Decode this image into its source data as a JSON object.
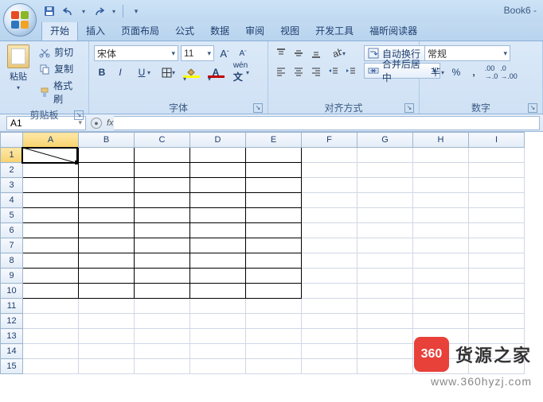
{
  "title": "Book6 -",
  "tabs": [
    "开始",
    "插入",
    "页面布局",
    "公式",
    "数据",
    "审阅",
    "视图",
    "开发工具",
    "福昕阅读器"
  ],
  "active_tab": 0,
  "clipboard": {
    "paste": "粘贴",
    "cut": "剪切",
    "copy": "复制",
    "format": "格式刷",
    "label": "剪贴板"
  },
  "font": {
    "name": "宋体",
    "size": "11",
    "label": "字体"
  },
  "align": {
    "wrap": "自动换行",
    "merge": "合并后居中",
    "label": "对齐方式"
  },
  "number": {
    "format": "常规",
    "label": "数字"
  },
  "namebox": "A1",
  "columns": [
    "A",
    "B",
    "C",
    "D",
    "E",
    "F",
    "G",
    "H",
    "I"
  ],
  "rows": [
    1,
    2,
    3,
    4,
    5,
    6,
    7,
    8,
    9,
    10,
    11,
    12,
    13,
    14,
    15
  ],
  "selected_col": 0,
  "selected_row": 0,
  "border_range": {
    "r1": 0,
    "r2": 9,
    "c1": 0,
    "c2": 4
  },
  "watermark": {
    "badge": "360",
    "text1": "货源之家",
    "text2": "www.360hyzj.com"
  }
}
